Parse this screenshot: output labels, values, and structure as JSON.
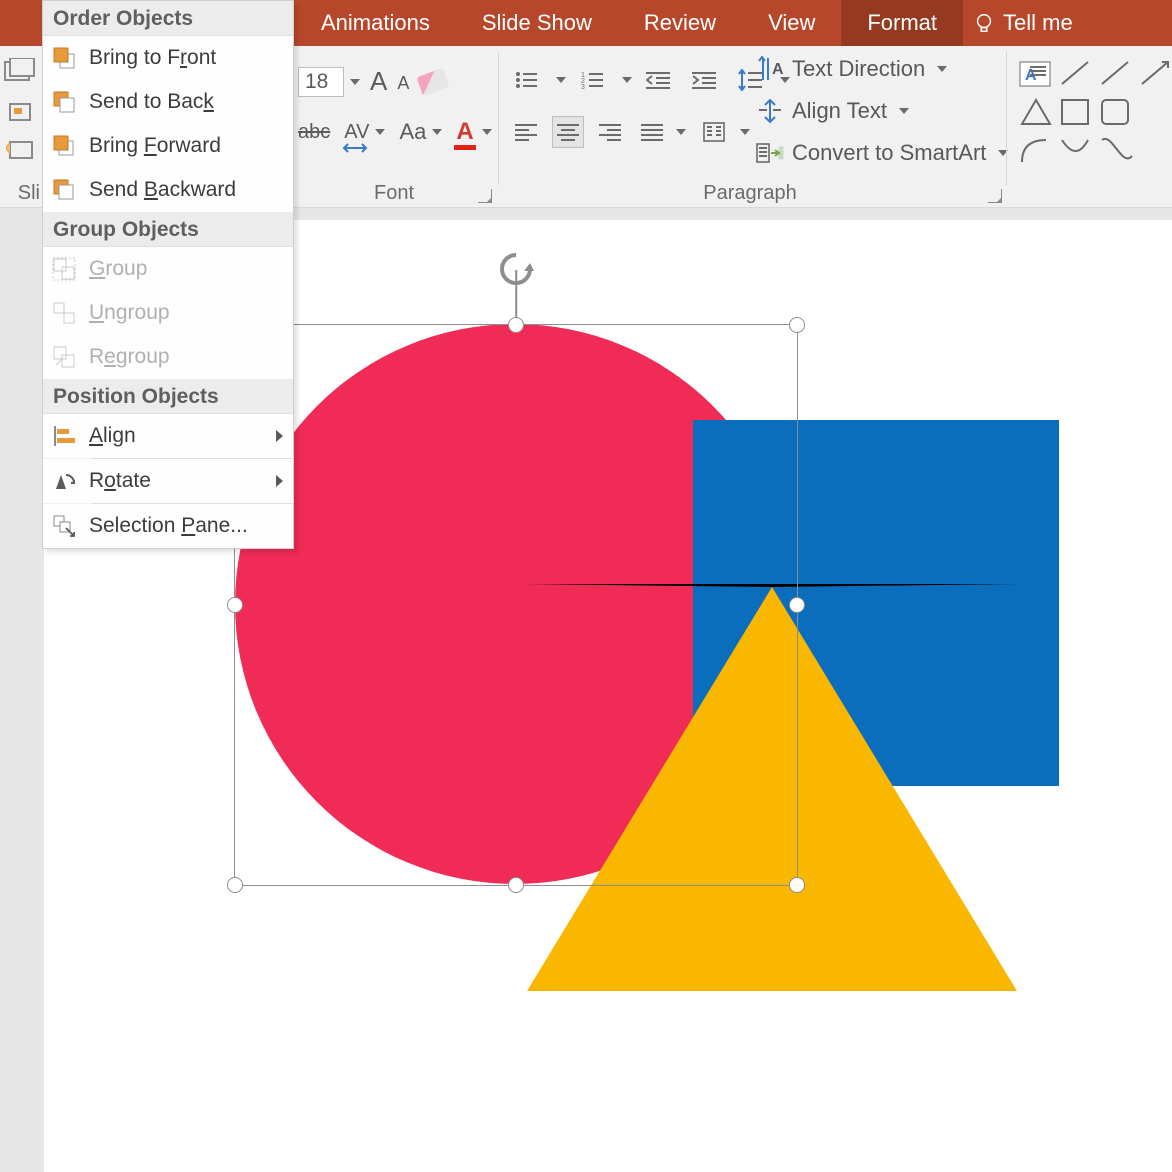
{
  "tabs": {
    "animations": "Animations",
    "slide_show": "Slide Show",
    "review": "Review",
    "view": "View",
    "format": "Format",
    "tell_me": "Tell me"
  },
  "ribbon": {
    "left_group_label": "Sli",
    "font": {
      "size_value": "18",
      "increase": "A",
      "decrease": "A",
      "strike": "abc",
      "spacing": "AV",
      "case": "Aa",
      "color": "A",
      "group_label": "Font"
    },
    "paragraph": {
      "group_label": "Paragraph",
      "text_direction": "Text Direction",
      "align_text": "Align Text",
      "convert_smartart": "Convert to SmartArt"
    }
  },
  "context_menu": {
    "order_header": "Order Objects",
    "bring_front": "Bring to Front",
    "send_back": "Send to Back",
    "bring_forward": "Bring Forward",
    "send_backward": "Send Backward",
    "group_header": "Group Objects",
    "group": "Group",
    "ungroup": "Ungroup",
    "regroup": "Regroup",
    "position_header": "Position Objects",
    "align": "Align",
    "rotate": "Rotate",
    "selection_pane": "Selection Pane..."
  },
  "shapes": {
    "circle_color": "#ef2b56",
    "square_color": "#0a6ebd",
    "triangle_color": "#f9b700"
  }
}
